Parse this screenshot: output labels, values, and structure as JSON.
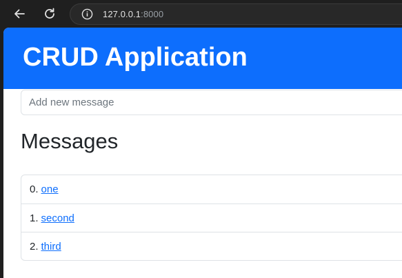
{
  "browser": {
    "url_host": "127.0.0.1",
    "url_port": ":8000",
    "back_icon": "arrow-left-icon",
    "reload_icon": "reload-icon",
    "info_icon": "info-icon"
  },
  "header": {
    "title": "CRUD Application",
    "bg_color": "#0d6efd"
  },
  "form": {
    "placeholder": "Add new message",
    "value": ""
  },
  "messages": {
    "heading": "Messages",
    "items": [
      {
        "index": "0.",
        "text": "one"
      },
      {
        "index": "1.",
        "text": "second"
      },
      {
        "index": "2.",
        "text": "third"
      }
    ]
  }
}
